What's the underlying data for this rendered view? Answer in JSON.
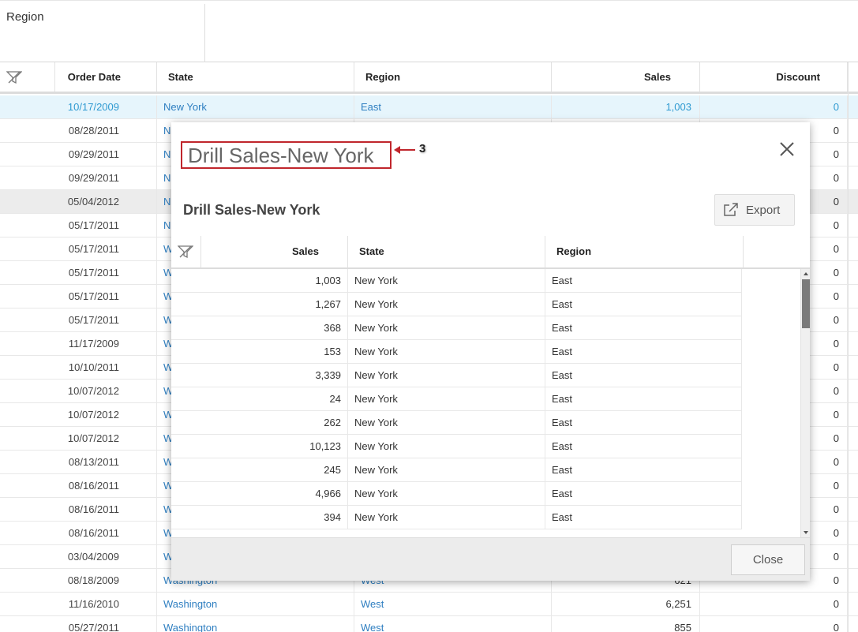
{
  "region_panel": {
    "label": "Region"
  },
  "grid": {
    "columns": {
      "order_date": "Order Date",
      "state": "State",
      "region": "Region",
      "sales": "Sales",
      "discount": "Discount"
    },
    "rows": [
      {
        "date": "10/17/2009",
        "state": "New York",
        "region": "East",
        "sales": "1,003",
        "discount": "0"
      },
      {
        "date": "08/28/2011",
        "state": "N",
        "region": "",
        "sales": "",
        "discount": "0"
      },
      {
        "date": "09/29/2011",
        "state": "N",
        "region": "",
        "sales": "",
        "discount": "0"
      },
      {
        "date": "09/29/2011",
        "state": "N",
        "region": "",
        "sales": "",
        "discount": "0"
      },
      {
        "date": "05/04/2012",
        "state": "N",
        "region": "",
        "sales": "",
        "discount": "0"
      },
      {
        "date": "05/17/2011",
        "state": "N",
        "region": "",
        "sales": "",
        "discount": "0"
      },
      {
        "date": "05/17/2011",
        "state": "W",
        "region": "",
        "sales": "",
        "discount": "0"
      },
      {
        "date": "05/17/2011",
        "state": "W",
        "region": "",
        "sales": "",
        "discount": "0"
      },
      {
        "date": "05/17/2011",
        "state": "W",
        "region": "",
        "sales": "",
        "discount": "0"
      },
      {
        "date": "05/17/2011",
        "state": "W",
        "region": "",
        "sales": "",
        "discount": "0"
      },
      {
        "date": "11/17/2009",
        "state": "W",
        "region": "",
        "sales": "",
        "discount": "0"
      },
      {
        "date": "10/10/2011",
        "state": "W",
        "region": "",
        "sales": "",
        "discount": "0"
      },
      {
        "date": "10/07/2012",
        "state": "W",
        "region": "",
        "sales": "",
        "discount": "0"
      },
      {
        "date": "10/07/2012",
        "state": "W",
        "region": "",
        "sales": "",
        "discount": "0"
      },
      {
        "date": "10/07/2012",
        "state": "W",
        "region": "",
        "sales": "",
        "discount": "0"
      },
      {
        "date": "08/13/2011",
        "state": "W",
        "region": "",
        "sales": "",
        "discount": "0"
      },
      {
        "date": "08/16/2011",
        "state": "W",
        "region": "",
        "sales": "",
        "discount": "0"
      },
      {
        "date": "08/16/2011",
        "state": "W",
        "region": "",
        "sales": "",
        "discount": "0"
      },
      {
        "date": "08/16/2011",
        "state": "W",
        "region": "",
        "sales": "",
        "discount": "0"
      },
      {
        "date": "03/04/2009",
        "state": "W",
        "region": "",
        "sales": "",
        "discount": "0"
      },
      {
        "date": "08/18/2009",
        "state": "Washington",
        "region": "West",
        "sales": "621",
        "discount": "0"
      },
      {
        "date": "11/16/2010",
        "state": "Washington",
        "region": "West",
        "sales": "6,251",
        "discount": "0"
      },
      {
        "date": "05/27/2011",
        "state": "Washington",
        "region": "West",
        "sales": "855",
        "discount": "0"
      }
    ]
  },
  "modal": {
    "title": "Drill Sales-New York",
    "annotation_number": "3",
    "subtitle": "Drill Sales-New York",
    "export_label": "Export",
    "close_label": "Close",
    "columns": {
      "sales": "Sales",
      "state": "State",
      "region": "Region"
    },
    "rows": [
      {
        "sales": "1,003",
        "state": "New York",
        "region": "East"
      },
      {
        "sales": "1,267",
        "state": "New York",
        "region": "East"
      },
      {
        "sales": "368",
        "state": "New York",
        "region": "East"
      },
      {
        "sales": "153",
        "state": "New York",
        "region": "East"
      },
      {
        "sales": "3,339",
        "state": "New York",
        "region": "East"
      },
      {
        "sales": "24",
        "state": "New York",
        "region": "East"
      },
      {
        "sales": "262",
        "state": "New York",
        "region": "East"
      },
      {
        "sales": "10,123",
        "state": "New York",
        "region": "East"
      },
      {
        "sales": "245",
        "state": "New York",
        "region": "East"
      },
      {
        "sales": "4,966",
        "state": "New York",
        "region": "East"
      },
      {
        "sales": "394",
        "state": "New York",
        "region": "East"
      }
    ]
  },
  "colors": {
    "link": "#2f7fc1",
    "selected_row": "#e6f5fc",
    "annotation": "#c0262c"
  }
}
